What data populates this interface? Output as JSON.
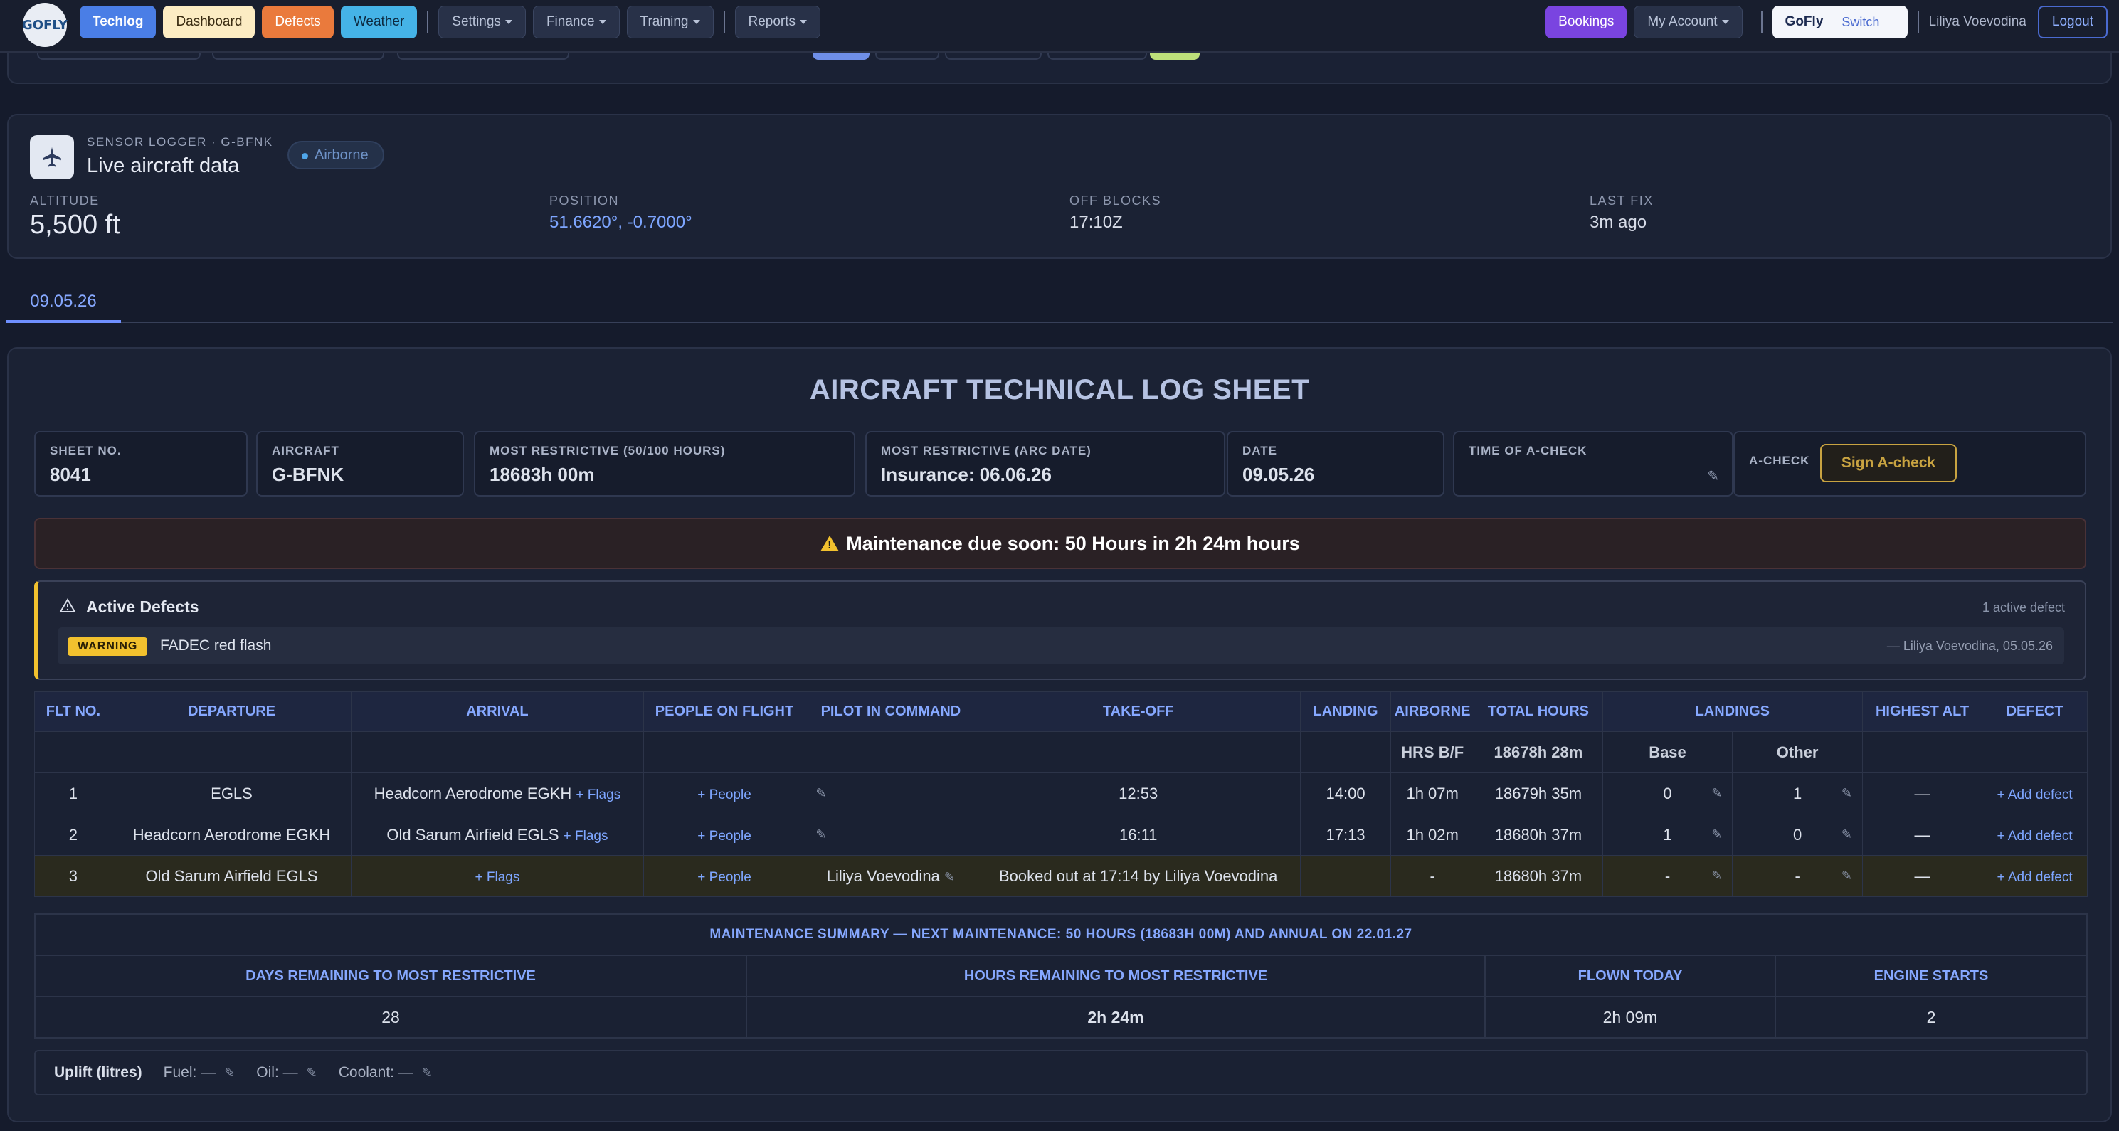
{
  "navbar": {
    "logo_text": "GOFLY",
    "left_buttons": [
      {
        "label": "Techlog",
        "style": "blue"
      },
      {
        "label": "Dashboard",
        "style": "cream"
      },
      {
        "label": "Defects",
        "style": "orange"
      },
      {
        "label": "Weather",
        "style": "sky"
      }
    ],
    "menus": [
      {
        "label": "Settings"
      },
      {
        "label": "Finance"
      },
      {
        "label": "Training"
      },
      {
        "label": "Reports"
      }
    ],
    "bookings_label": "Bookings",
    "account_label": "My Account",
    "switch_brand": "GoFly",
    "switch_label": "Switch",
    "user_name": "Liliya Voevodina",
    "logout_label": "Logout"
  },
  "sensor": {
    "kicker": "SENSOR LOGGER · G-BFNK",
    "title": "Live aircraft data",
    "status": "Airborne",
    "stats": [
      {
        "label": "ALTITUDE",
        "value": "5,500 ft"
      },
      {
        "label": "POSITION",
        "value": "51.6620°, -0.7000°"
      },
      {
        "label": "OFF BLOCKS",
        "value": "17:10Z"
      },
      {
        "label": "LAST FIX",
        "value": "3m ago"
      }
    ]
  },
  "tabs": {
    "date": "09.05.26"
  },
  "sheet": {
    "title": "AIRCRAFT TECHNICAL LOG SHEET",
    "boxes": {
      "sheet_no_label": "SHEET NO.",
      "sheet_no": "8041",
      "aircraft_label": "AIRCRAFT",
      "aircraft": "G-BFNK",
      "restrictive_hours_label": "MOST RESTRICTIVE (50/100 HOURS)",
      "restrictive_hours": "18683h 00m",
      "restrictive_date_label": "MOST RESTRICTIVE (ARC DATE)",
      "restrictive_date": "Insurance: 06.06.26",
      "date_label": "DATE",
      "date": "09.05.26",
      "acheck_time_label": "TIME OF A-CHECK",
      "acheck_label": "A-CHECK",
      "sign_label": "Sign A-check"
    },
    "maintenance_banner": "Maintenance due soon: 50 Hours in 2h 24m hours",
    "defects": {
      "title": "Active Defects",
      "count": "1 active defect",
      "items": [
        {
          "severity": "WARNING",
          "text": "FADEC red flash",
          "by": "— Liliya Voevodina, 05.05.26"
        }
      ]
    },
    "flights": {
      "headers": [
        "FLT NO.",
        "DEPARTURE",
        "ARRIVAL",
        "PEOPLE ON FLIGHT",
        "PILOT IN COMMAND",
        "TAKE-OFF",
        "LANDING",
        "AIRBORNE",
        "TOTAL HOURS",
        "LANDINGS",
        "HIGHEST ALT",
        "DEFECT"
      ],
      "sub": {
        "hrs_bf_label": "HRS B/F",
        "hrs_bf": "18678h 28m",
        "base_label": "Base",
        "other_label": "Other"
      },
      "flags_link": "+ Flags",
      "people_link": "+ People",
      "add_defect_link": "+ Add defect",
      "rows": [
        {
          "no": "1",
          "departure": "EGLS",
          "arrival": "Headcorn Aerodrome EGKH",
          "pic": "",
          "takeoff": "12:53",
          "landing": "14:00",
          "airborne": "1h 07m",
          "total": "18679h 35m",
          "base": "0",
          "other": "1",
          "alt": "—"
        },
        {
          "no": "2",
          "departure": "Headcorn Aerodrome EGKH",
          "arrival": "Old Sarum Airfield EGLS",
          "pic": "",
          "takeoff": "16:11",
          "landing": "17:13",
          "airborne": "1h 02m",
          "total": "18680h 37m",
          "base": "1",
          "other": "0",
          "alt": "—"
        },
        {
          "no": "3",
          "departure": "Old Sarum Airfield EGLS",
          "arrival": "",
          "pic": "Liliya Voevodina",
          "takeoff": "Booked out at 17:14 by Liliya Voevodina",
          "landing": "",
          "airborne": "-",
          "total": "18680h 37m",
          "base": "-",
          "other": "-",
          "alt": "—"
        }
      ]
    },
    "maintenance_summary": {
      "title": "MAINTENANCE SUMMARY — NEXT MAINTENANCE: 50 HOURS (18683H 00M) AND ANNUAL ON 22.01.27",
      "cols": [
        {
          "label": "DAYS REMAINING TO MOST RESTRICTIVE",
          "value": "28"
        },
        {
          "label": "HOURS REMAINING TO MOST RESTRICTIVE",
          "value": "2h 24m"
        },
        {
          "label": "FLOWN TODAY",
          "value": "2h 09m"
        },
        {
          "label": "ENGINE STARTS",
          "value": "2"
        }
      ]
    },
    "uplift": {
      "title": "Uplift (litres)",
      "items": [
        {
          "label": "Fuel:",
          "value": "—"
        },
        {
          "label": "Oil:",
          "value": "—"
        },
        {
          "label": "Coolant:",
          "value": "—"
        }
      ]
    }
  },
  "colors": {
    "accent": "#4a7ee6",
    "link": "#7ea6ff",
    "warning": "#f2c12e",
    "background": "#151b2c"
  }
}
